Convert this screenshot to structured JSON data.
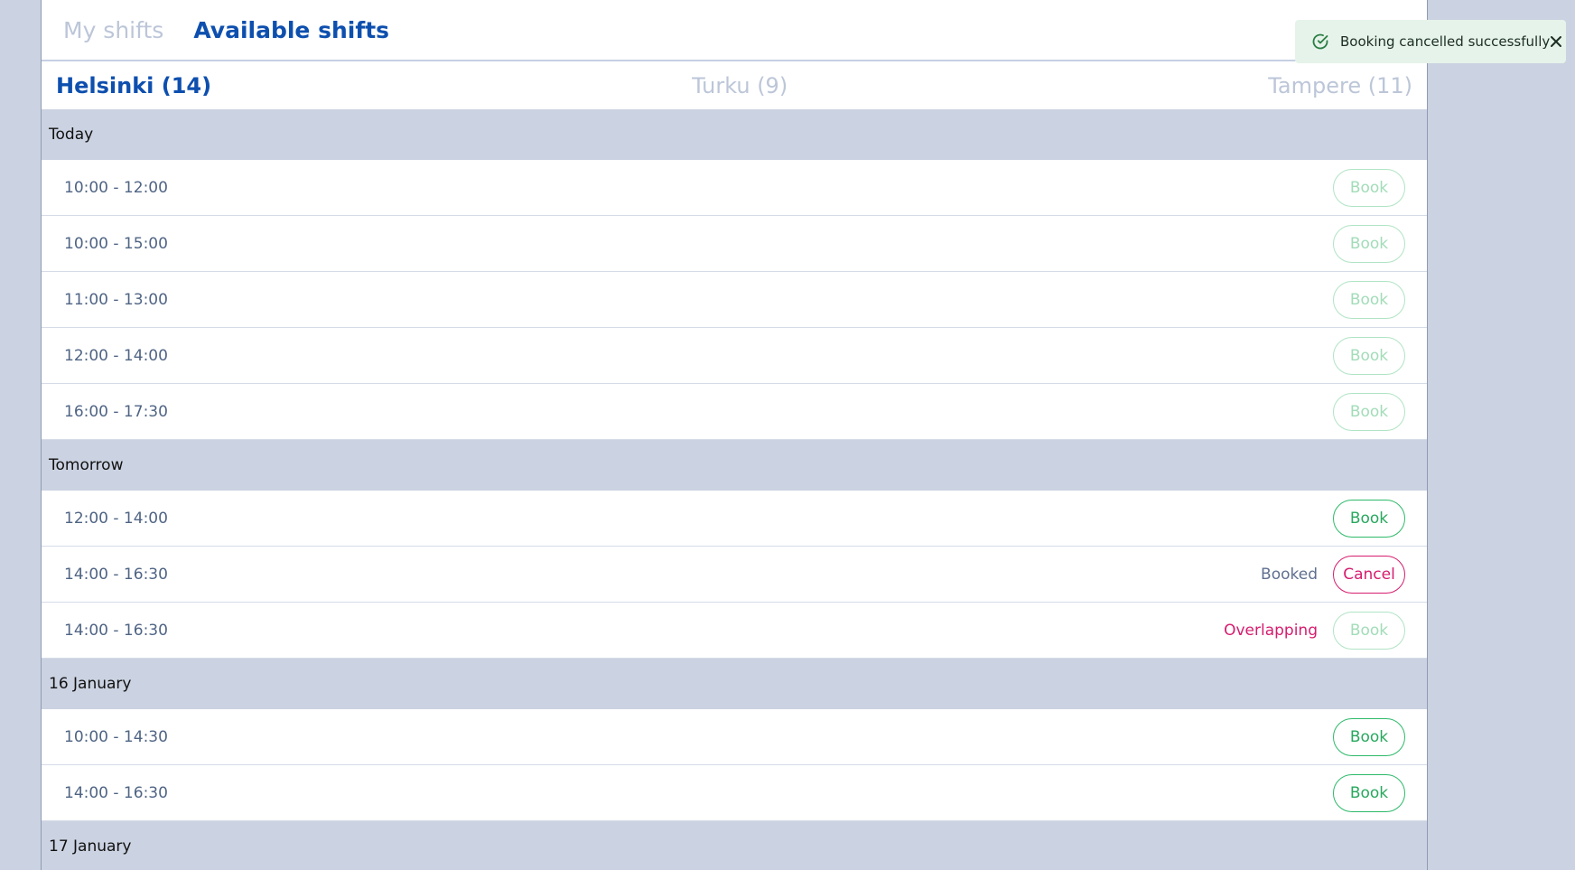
{
  "tabs": [
    {
      "label": "My shifts",
      "active": false
    },
    {
      "label": "Available shifts",
      "active": true
    }
  ],
  "cities": [
    {
      "label": "Helsinki (14)",
      "active": true
    },
    {
      "label": "Turku (9)",
      "active": false
    },
    {
      "label": "Tampere (11)",
      "active": false
    }
  ],
  "days": [
    {
      "label": "Today",
      "shifts": [
        {
          "time": "10:00 - 12:00",
          "status": "",
          "button": "Book",
          "state": "disabled"
        },
        {
          "time": "10:00 - 15:00",
          "status": "",
          "button": "Book",
          "state": "disabled"
        },
        {
          "time": "11:00 - 13:00",
          "status": "",
          "button": "Book",
          "state": "disabled"
        },
        {
          "time": "12:00 - 14:00",
          "status": "",
          "button": "Book",
          "state": "disabled"
        },
        {
          "time": "16:00 - 17:30",
          "status": "",
          "button": "Book",
          "state": "disabled"
        }
      ]
    },
    {
      "label": "Tomorrow",
      "shifts": [
        {
          "time": "12:00 - 14:00",
          "status": "",
          "button": "Book",
          "state": "enabled"
        },
        {
          "time": "14:00 - 16:30",
          "status": "Booked",
          "button": "Cancel",
          "state": "cancel"
        },
        {
          "time": "14:00 - 16:30",
          "status": "Overlapping",
          "button": "Book",
          "state": "disabled"
        }
      ]
    },
    {
      "label": "16 January",
      "shifts": [
        {
          "time": "10:00 - 14:30",
          "status": "",
          "button": "Book",
          "state": "enabled"
        },
        {
          "time": "14:00 - 16:30",
          "status": "",
          "button": "Book",
          "state": "enabled"
        }
      ]
    },
    {
      "label": "17 January",
      "shifts": []
    }
  ],
  "toast": {
    "message": "Booking cancelled successfully",
    "icon": "check-circle-icon",
    "close_icon": "close-icon"
  },
  "colors": {
    "primary": "#0d4fae",
    "success": "#28a85e",
    "danger": "#d61c6e",
    "header_bg": "#cbd2e1"
  }
}
